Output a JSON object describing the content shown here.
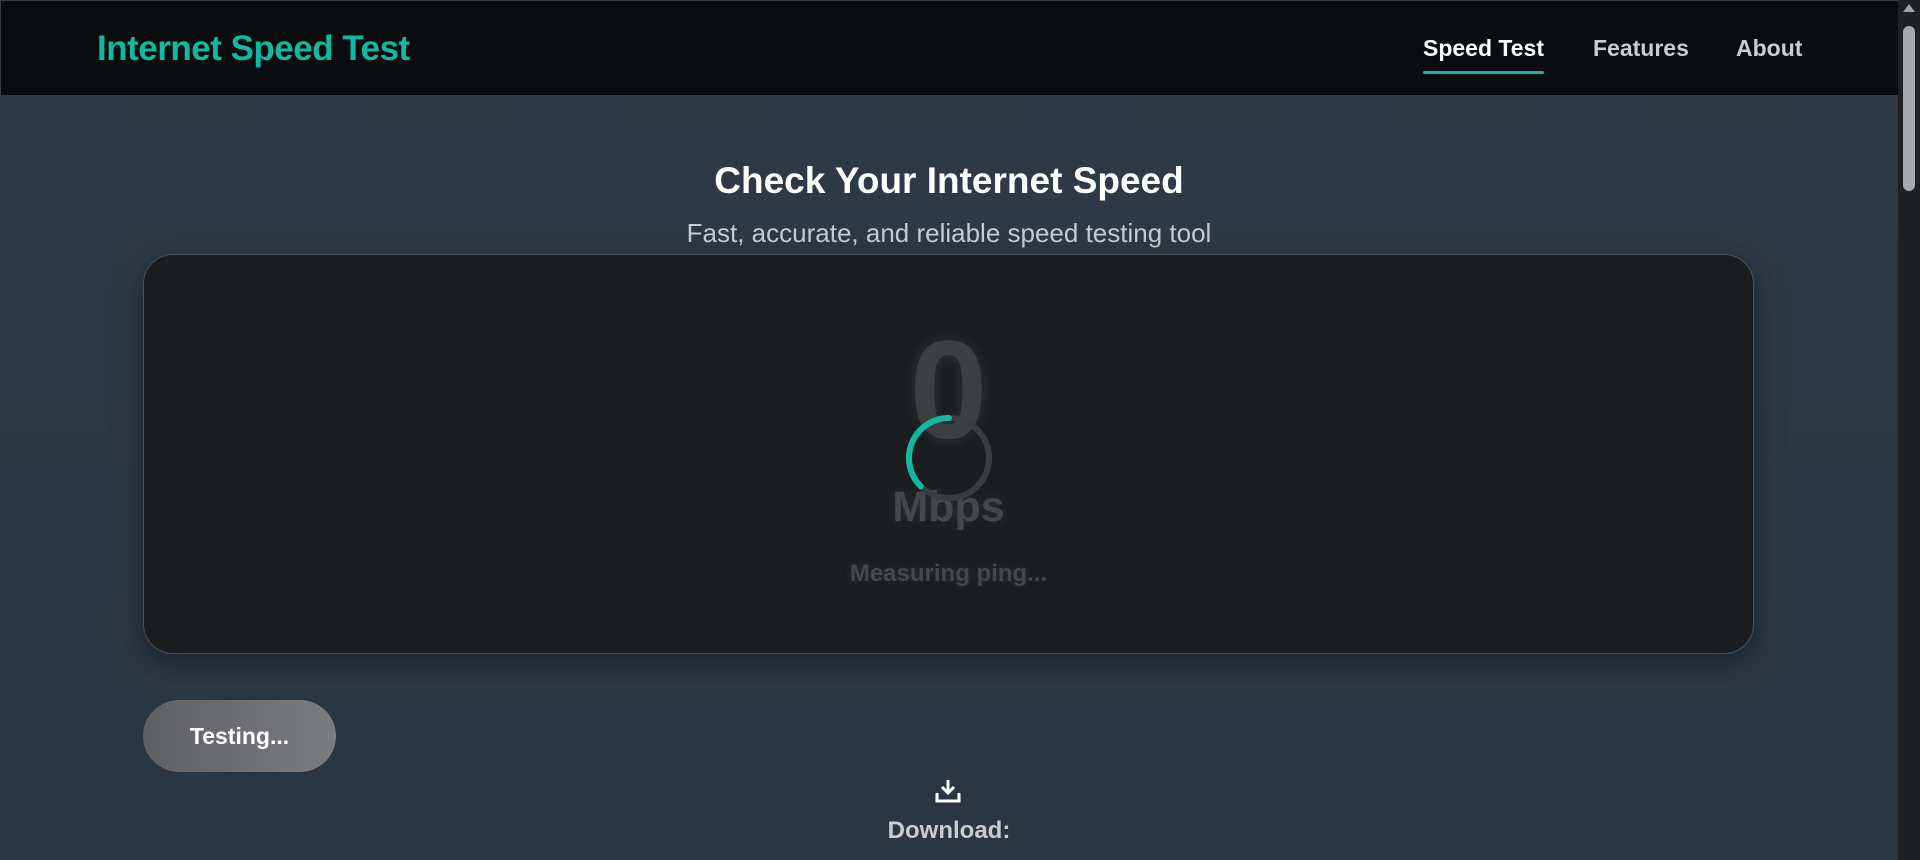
{
  "header": {
    "brand": "Internet Speed Test",
    "nav": [
      {
        "label": "Speed Test",
        "active": true
      },
      {
        "label": "Features",
        "active": false
      },
      {
        "label": "About",
        "active": false
      }
    ]
  },
  "hero": {
    "title": "Check Your Internet Speed",
    "subtitle": "Fast, accurate, and reliable speed testing tool"
  },
  "gauge": {
    "value": "0",
    "unit": "Mbps",
    "status": "Measuring ping..."
  },
  "controls": {
    "test_button_label": "Testing..."
  },
  "results": {
    "download_label": "Download:"
  },
  "colors": {
    "accent": "#14b8a0",
    "nav_bg": "#0a0d10",
    "panel_bg": "#1b1e21"
  }
}
